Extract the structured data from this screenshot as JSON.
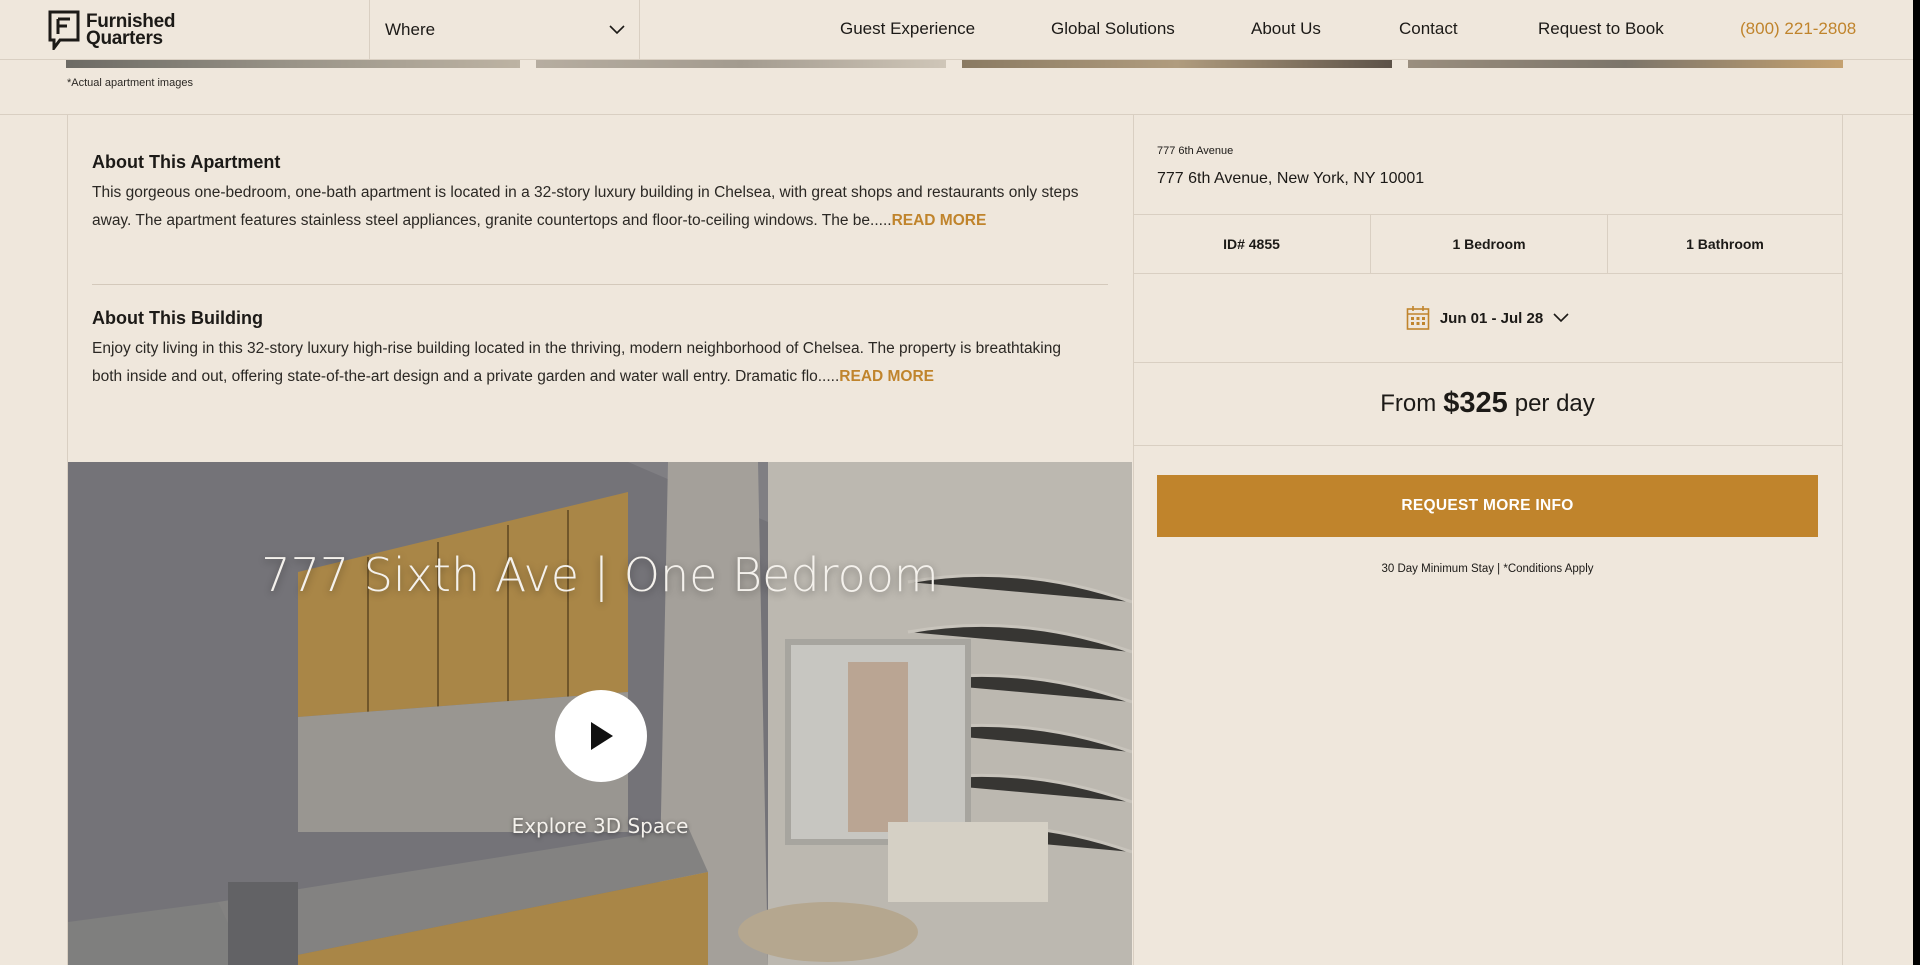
{
  "header": {
    "logo_line1": "Furnished",
    "logo_line2": "Quarters",
    "where_label": "Where",
    "nav": [
      "Guest Experience",
      "Global Solutions",
      "About Us",
      "Contact",
      "Request to Book"
    ],
    "phone": "(800) 221-2808"
  },
  "note": "*Actual apartment images",
  "apartment": {
    "heading": "About This Apartment",
    "text": "This gorgeous one-bedroom, one-bath apartment is located in a 32-story luxury building in Chelsea, with great shops and restaurants only steps away. The apartment features stainless steel appliances, granite countertops and floor-to-ceiling windows. The be.....",
    "read_more": "READ MORE"
  },
  "building": {
    "heading": "About This Building",
    "text": "Enjoy city living in this 32-story luxury high-rise building located in the thriving, modern neighborhood of Chelsea. The property is breathtaking both inside and out, offering state-of-the-art design and a private garden and water wall entry. Dramatic flo.....",
    "read_more": "READ MORE"
  },
  "video": {
    "title": "777 Sixth Ave | One Bedroom",
    "explore": "Explore 3D Space"
  },
  "listing": {
    "address_short": "777 6th Avenue",
    "address_full": "777 6th Avenue, New York, NY 10001",
    "id": "ID# 4855",
    "bedrooms": "1 Bedroom",
    "bathrooms": "1 Bathroom",
    "dates": "Jun 01 - Jul 28",
    "price_from": "From",
    "price": "$325",
    "price_unit": "per day",
    "cta": "REQUEST MORE INFO",
    "min_stay": "30 Day Minimum Stay | *Conditions Apply"
  },
  "colors": {
    "background": "#efe7dc",
    "accent": "#c0842c",
    "border": "#d9cfc2"
  }
}
